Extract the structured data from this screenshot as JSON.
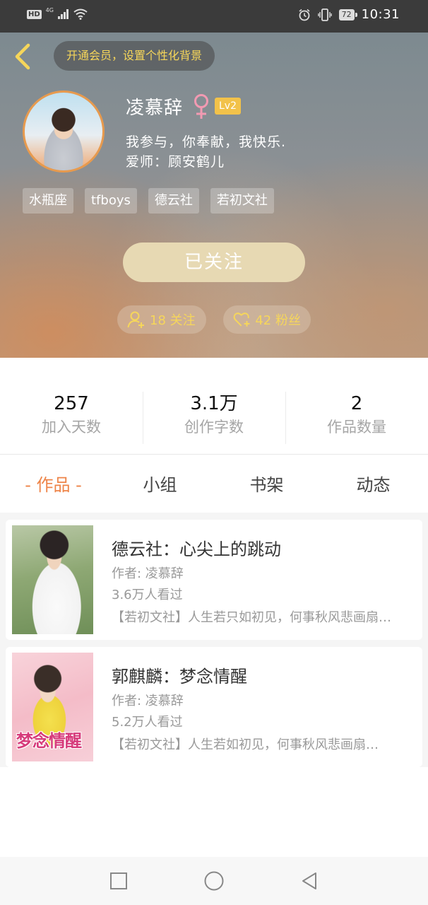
{
  "status_bar": {
    "hd": "HD",
    "network": "4G",
    "battery": "72",
    "time": "10:31"
  },
  "header": {
    "background_pill": "开通会员，设置个性化背景",
    "username": "凌慕辞",
    "level": "Lv2",
    "bio": "我参与，你奉献，我快乐.",
    "mentor": "爱师：顾安鹤儿",
    "tags": [
      "水瓶座",
      "tfboys",
      "德云社",
      "若初文社"
    ],
    "follow_button": "已关注",
    "following_label": "18 关注",
    "fans_label": "42 粉丝"
  },
  "stats": [
    {
      "value": "257",
      "label": "加入天数"
    },
    {
      "value": "3.1万",
      "label": "创作字数"
    },
    {
      "value": "2",
      "label": "作品数量"
    }
  ],
  "tabs": [
    {
      "label": "- 作品 -",
      "active": true
    },
    {
      "label": "小组",
      "active": false
    },
    {
      "label": "书架",
      "active": false
    },
    {
      "label": "动态",
      "active": false
    }
  ],
  "works": [
    {
      "title": "德云社：心尖上的跳动",
      "author": "作者: 凌慕辞",
      "views": "3.6万人看过",
      "intro": "【若初文社】人生若只如初见，何事秋风悲画扇…"
    },
    {
      "title": "郭麒麟：梦念情醒",
      "author": "作者: 凌慕辞",
      "views": "5.2万人看过",
      "intro": "【若初文社】人生若如初见，何事秋风悲画扇…",
      "cover_text": "梦念情醒"
    }
  ],
  "colors": {
    "accent": "#ee8448",
    "gold_text": "#f6d65a",
    "level_badge": "#f2c24a",
    "follow_button": "#e7d9b3"
  }
}
